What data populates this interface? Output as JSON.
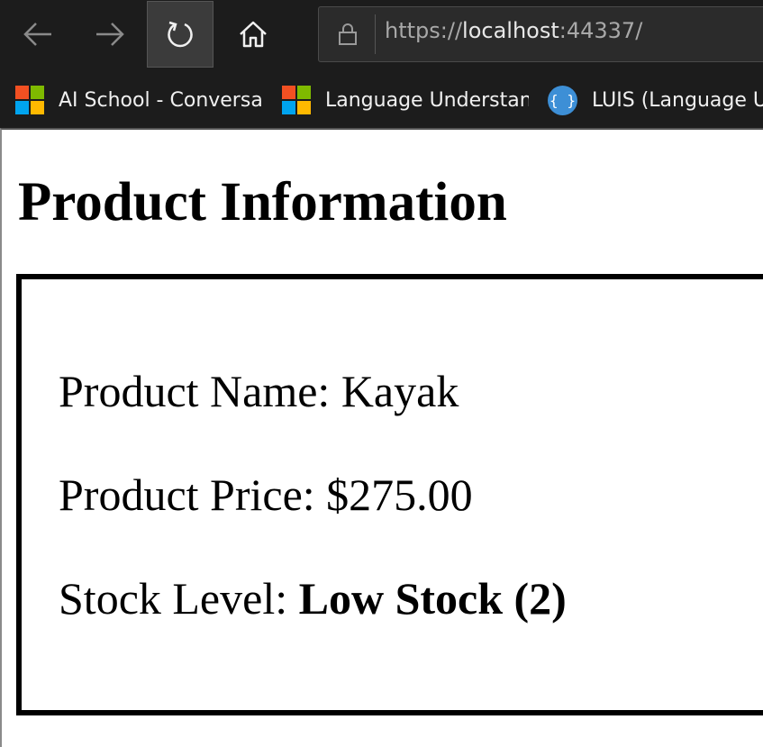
{
  "browser": {
    "url_scheme": "https://",
    "url_host": "localhost",
    "url_rest": ":44337/",
    "icons": {
      "back": "back-arrow-icon",
      "forward": "forward-arrow-icon",
      "refresh": "refresh-icon",
      "home": "home-icon",
      "lock": "lock-icon"
    },
    "bookmarks": [
      {
        "label": "AI School - Conversat",
        "icon": "microsoft-logo-icon"
      },
      {
        "label": "Language Understanc",
        "icon": "microsoft-logo-icon"
      },
      {
        "label": "LUIS (Language Un",
        "icon": "json-braces-icon"
      }
    ]
  },
  "page": {
    "title": "Product Information",
    "product_name_label": "Product Name: ",
    "product_name": "Kayak",
    "product_price_label": "Product Price: ",
    "product_price": "$275.00",
    "stock_level_label": "Stock Level: ",
    "stock_level": "Low Stock (2)"
  },
  "colors": {
    "browser_chrome": "#1c1c1c",
    "json_icon": "#3d8fd6"
  }
}
